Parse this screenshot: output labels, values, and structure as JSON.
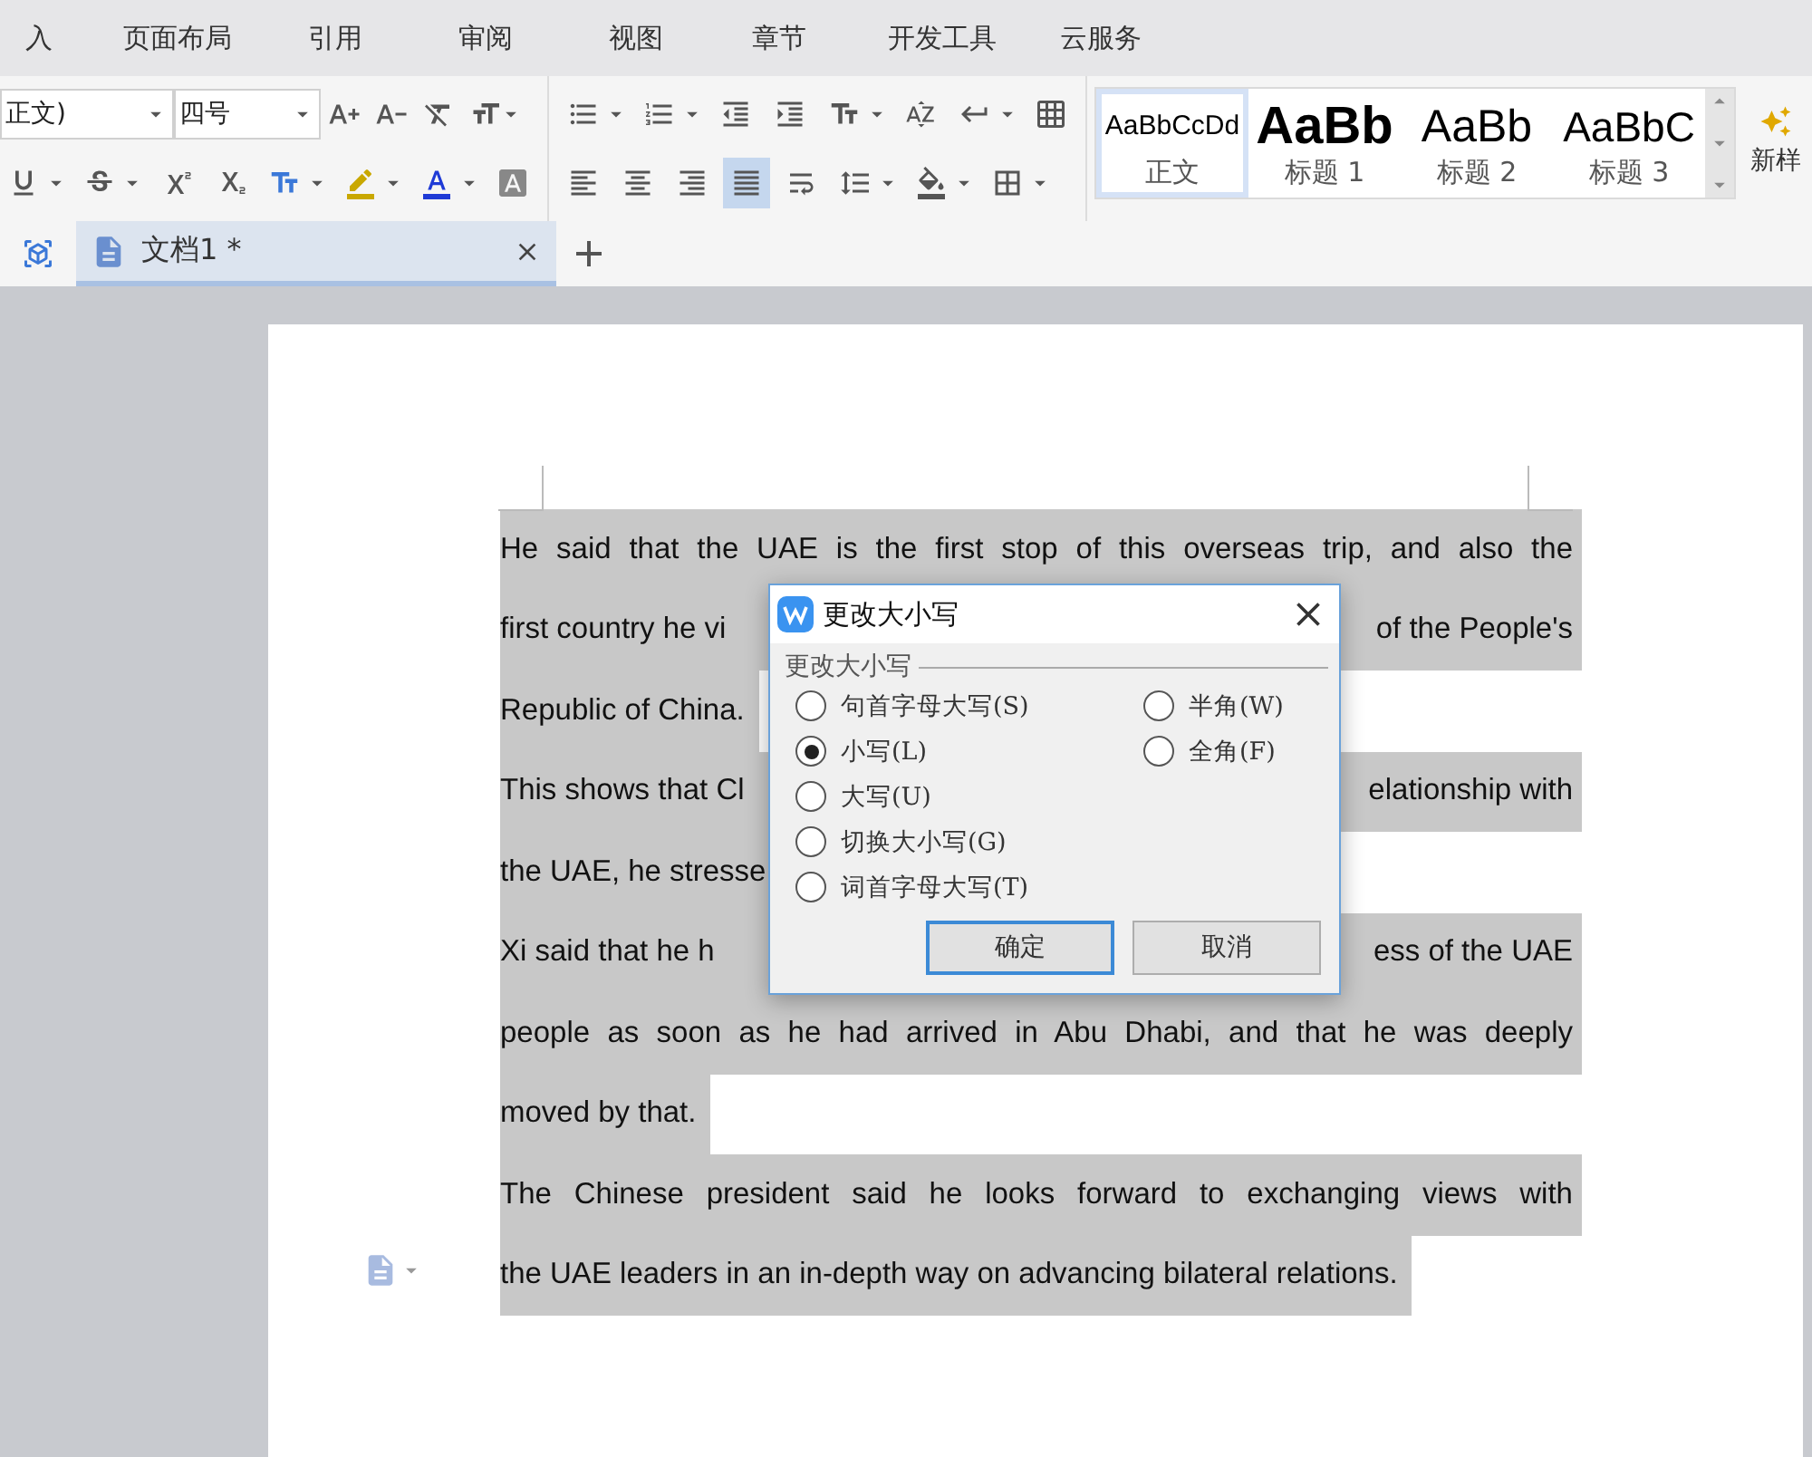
{
  "menu": [
    {
      "label": "入"
    },
    {
      "label": "页面布局"
    },
    {
      "label": "引用"
    },
    {
      "label": "审阅"
    },
    {
      "label": "视图"
    },
    {
      "label": "章节"
    },
    {
      "label": "开发工具"
    },
    {
      "label": "云服务"
    }
  ],
  "toolbar": {
    "font_name": "正文)",
    "font_size": "四号",
    "alignment": [
      {
        "kind": "left",
        "selected": false
      },
      {
        "kind": "center",
        "selected": false
      },
      {
        "kind": "right",
        "selected": false
      },
      {
        "kind": "justify",
        "selected": true
      },
      {
        "kind": "distribute",
        "selected": false
      }
    ],
    "styles": [
      {
        "preview": "AaBbCcDd",
        "label": "正文",
        "kind": "body",
        "selected": true
      },
      {
        "preview": "AaBb",
        "label": "标题 1",
        "kind": "h1",
        "selected": false
      },
      {
        "preview": "AaBb",
        "label": "标题 2",
        "kind": "h2",
        "selected": false
      },
      {
        "preview": "AaBbC",
        "label": "标题 3",
        "kind": "h3",
        "selected": false
      }
    ],
    "new_style": "新样"
  },
  "tabs": [
    {
      "label": "文档1 *",
      "selected": true
    }
  ],
  "document": {
    "lines": [
      {
        "kind": "justified",
        "parts": [
          "He said that the UAE is the first stop of this overseas trip, and also the"
        ]
      },
      {
        "kind": "split",
        "parts": [
          "first country he vi",
          "of the People's"
        ]
      },
      {
        "kind": "last",
        "parts": [
          "Republic of China."
        ]
      },
      {
        "kind": "split",
        "parts": [
          "This shows that Cl",
          "elationship with"
        ]
      },
      {
        "kind": "last",
        "parts": [
          "the UAE, he stresse"
        ]
      },
      {
        "kind": "split",
        "parts": [
          "Xi said that he h",
          "ess of the UAE"
        ]
      },
      {
        "kind": "justified",
        "parts": [
          "people as soon as he had arrived in Abu Dhabi, and that he was deeply"
        ]
      },
      {
        "kind": "last",
        "parts": [
          "moved by that."
        ]
      },
      {
        "kind": "justified",
        "parts": [
          "The Chinese president said he looks forward to exchanging views with"
        ]
      },
      {
        "kind": "last",
        "parts": [
          "the UAE leaders in an in-depth way on advancing bilateral relations."
        ]
      }
    ]
  },
  "dialog": {
    "title": "更改大小写",
    "group": "更改大小写",
    "case_options": [
      {
        "label": "句首字母大写(S)",
        "selected": false
      },
      {
        "label": "小写(L)",
        "selected": true
      },
      {
        "label": "大写(U)",
        "selected": false
      },
      {
        "label": "切换大小写(G)",
        "selected": false
      },
      {
        "label": "词首字母大写(T)",
        "selected": false
      }
    ],
    "width_options": [
      {
        "label": "半角(W)",
        "selected": false
      },
      {
        "label": "全角(F)",
        "selected": false
      }
    ],
    "buttons": [
      {
        "label": "确定",
        "kind": "primary"
      },
      {
        "label": "取消",
        "kind": "secondary"
      }
    ]
  }
}
